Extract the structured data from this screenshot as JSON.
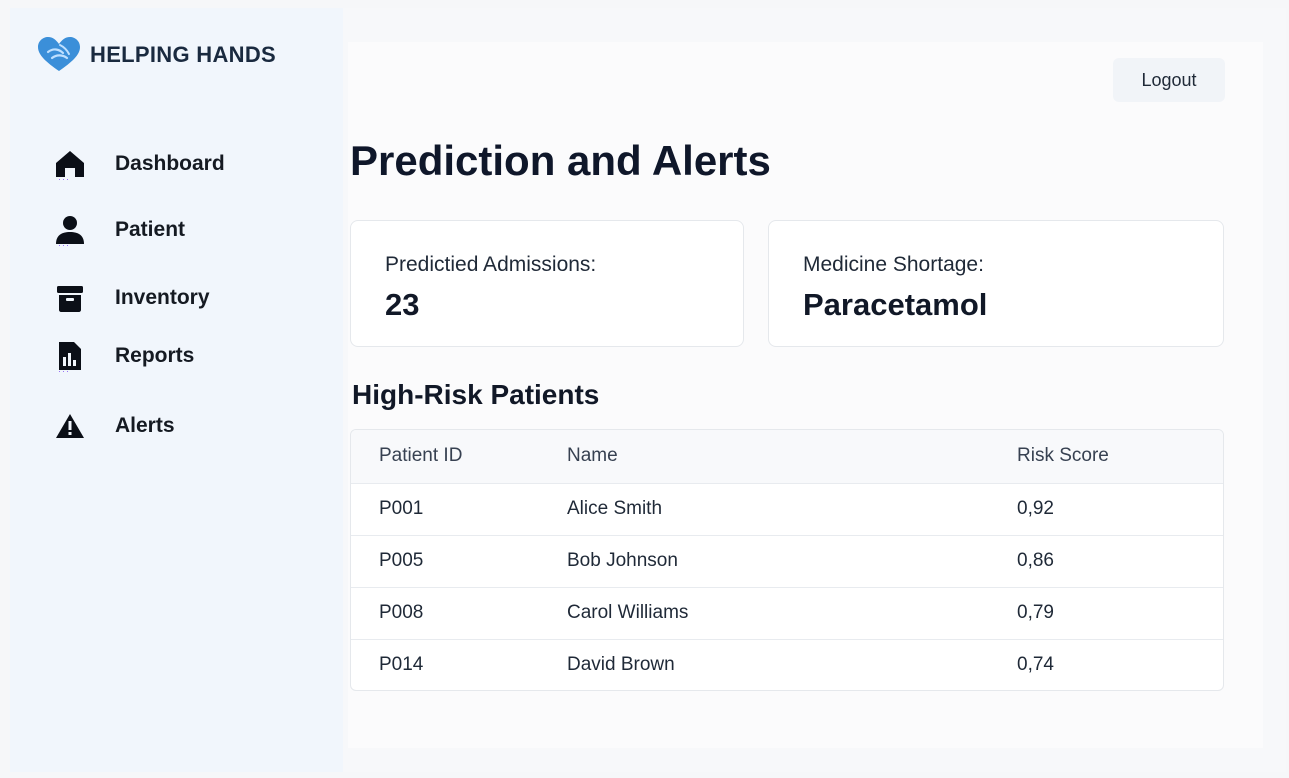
{
  "app": {
    "brand": "HELPING HANDS",
    "brand_color": "#3b8fd9"
  },
  "sidebar": {
    "items": [
      {
        "label": "Dashboard",
        "icon": "home-icon"
      },
      {
        "label": "Patient",
        "icon": "user-icon"
      },
      {
        "label": "Inventory",
        "icon": "archive-icon"
      },
      {
        "label": "Reports",
        "icon": "report-icon"
      },
      {
        "label": "Alerts",
        "icon": "warning-icon"
      }
    ]
  },
  "header": {
    "logout_label": "Logout"
  },
  "main": {
    "title": "Prediction and Alerts",
    "cards": [
      {
        "label": "Predictied Admissions:",
        "value": "23"
      },
      {
        "label": "Medicine Shortage:",
        "value": "Paracetamol"
      }
    ],
    "section_title": "High-Risk Patients",
    "table": {
      "columns": [
        "Patient ID",
        "Name",
        "Risk Score"
      ],
      "rows": [
        [
          "P001",
          "Alice Smith",
          "0,92"
        ],
        [
          "P005",
          "Bob Johnson",
          "0,86"
        ],
        [
          "P008",
          "Carol Williams",
          "0,79"
        ],
        [
          "P014",
          "David Brown",
          "0,74"
        ]
      ]
    }
  }
}
